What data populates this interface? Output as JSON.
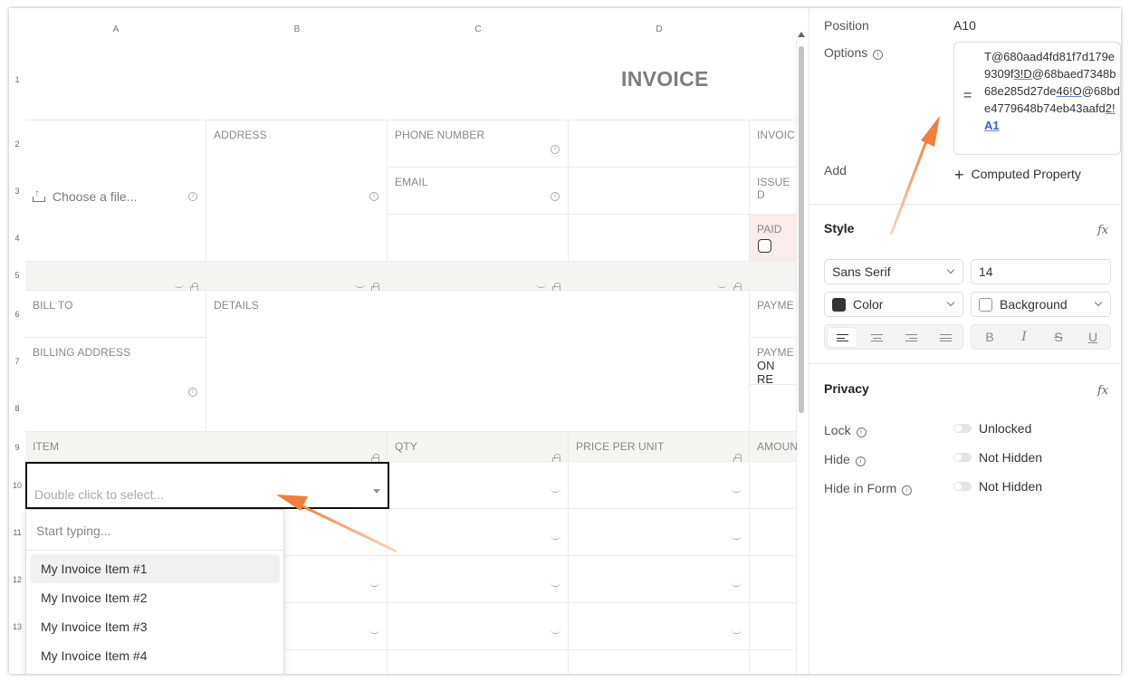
{
  "sheet": {
    "columns": [
      "A",
      "B",
      "C",
      "D"
    ],
    "rows": [
      "1",
      "2",
      "3",
      "4",
      "5",
      "6",
      "7",
      "8",
      "9",
      "10",
      "11",
      "12",
      "13"
    ],
    "title": "INVOICE",
    "labels": {
      "address": "ADDRESS",
      "phone": "PHONE NUMBER",
      "email": "EMAIL",
      "invoice": "INVOIC",
      "issue": "ISSUE D",
      "paid": "PAID",
      "bill_to": "BILL TO",
      "details": "DETAILS",
      "payme1": "PAYME",
      "billing_address": "BILLING ADDRESS",
      "payme2": "PAYME",
      "on_re": "ON RE",
      "item": "ITEM",
      "qty": "QTY",
      "price": "PRICE PER UNIT",
      "amount": "AMOUN"
    },
    "choose_file": "Choose a file...",
    "selected_placeholder": "Double click to select...",
    "dropdown": {
      "search_placeholder": "Start typing...",
      "options": [
        "My Invoice Item #1",
        "My Invoice Item #2",
        "My Invoice Item #3",
        "My Invoice Item #4"
      ]
    }
  },
  "panel": {
    "position_label": "Position",
    "position_value": "A10",
    "options_label": "Options",
    "options_eq": "=",
    "options_parts": {
      "p1": "T@680aad4fd81f7d179e9309f",
      "u1": "3!D",
      "p2": "@68baed7348b68e285d27de",
      "u2": "46!O",
      "p3": "@68bde4779648b74eb43aafd",
      "u3": "2!",
      "b3": "A1"
    },
    "add_label": "Add",
    "computed_property": "Computed Property",
    "style_title": "Style",
    "font_value": "Sans Serif",
    "size_value": "14",
    "color_label": "Color",
    "background_label": "Background",
    "color_swatch": "#333333",
    "privacy_title": "Privacy",
    "lock_label": "Lock",
    "lock_value": "Unlocked",
    "hide_label": "Hide",
    "hide_value": "Not Hidden",
    "hide_form_label": "Hide in Form",
    "hide_form_value": "Not Hidden",
    "fx_symbol": "fx"
  },
  "colors": {
    "accent_arrow": "#f07f3c",
    "paid_bg": "#fbecec"
  }
}
